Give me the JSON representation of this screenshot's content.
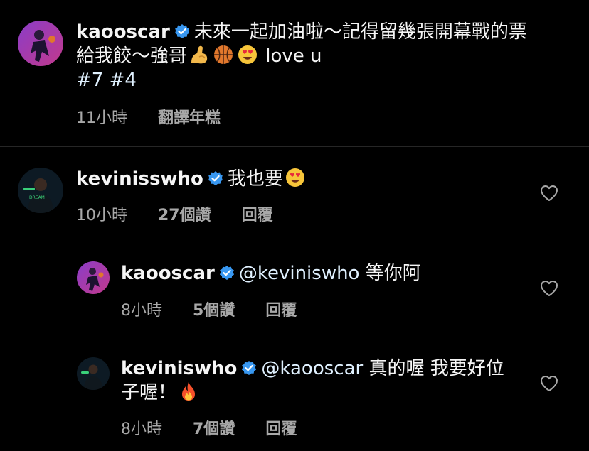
{
  "post": {
    "username": "kaooscar",
    "caption_line1": "未來一起加油啦～記得留幾張開幕戰的票",
    "caption_line2": "給我餃～強哥",
    "caption_love": "love u",
    "hashtags": "#7 #4",
    "time": "11小時",
    "translate": "翻譯年糕"
  },
  "comments": [
    {
      "username": "kevinisswho",
      "text": "我也要",
      "time": "10小時",
      "likes": "27個讚",
      "reply": "回覆"
    },
    {
      "username": "kaooscar",
      "mention": "@keviniswho",
      "text": "等你阿",
      "time": "8小時",
      "likes": "5個讚",
      "reply": "回覆"
    },
    {
      "username": "keviniswho",
      "mention": "@kaooscar",
      "text_line1": "真的喔 我要好位",
      "text_line2": "子喔！",
      "time": "8小時",
      "likes": "7個讚",
      "reply": "回覆"
    }
  ],
  "colors": {
    "background": "#000000",
    "text": "#f5f5f5",
    "meta": "#a8a8a8",
    "verified": "#3897f0",
    "divider": "#262626"
  }
}
